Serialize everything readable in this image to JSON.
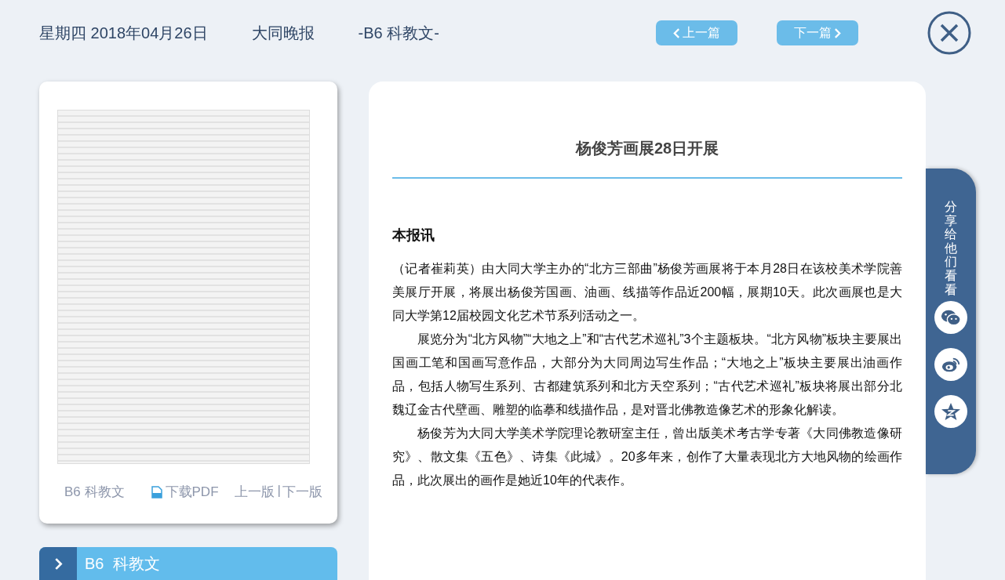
{
  "header": {
    "date": "星期四 2018年04月26日",
    "paper": "大同晚报",
    "page_label": "-B6 科教文-"
  },
  "nav_buttons": [
    {
      "kind": "prev",
      "label": "上一篇"
    },
    {
      "kind": "next",
      "label": "下一篇"
    }
  ],
  "page_card": {
    "page_name": "B6 科教文",
    "download": "下载PDF",
    "prev_page": "上一版",
    "separator": "|",
    "next_page": "下一版"
  },
  "section_tab": {
    "label": "B6  科教文"
  },
  "article": {
    "title": "杨俊芳画展28日开展",
    "lead": "本报讯",
    "paragraphs": [
      {
        "indent": false,
        "text": "（记者崔莉英）由大同大学主办的“北方三部曲”杨俊芳画展将于本月28日在该校美术学院善美展厅开展，将展出杨俊芳国画、油画、线描等作品近200幅，展期10天。此次画展也是大同大学第12届校园文化艺术节系列活动之一。"
      },
      {
        "indent": true,
        "text": "展览分为“北方风物”“大地之上”和“古代艺术巡礼”3个主题板块。“北方风物”板块主要展出国画工笔和国画写意作品，大部分为大同周边写生作品；“大地之上”板块主要展出油画作品，包括人物写生系列、古都建筑系列和北方天空系列；“古代艺术巡礼”板块将展出部分北魏辽金古代壁画、雕塑的临摹和线描作品，是对晋北佛教造像艺术的形象化解读。"
      },
      {
        "indent": true,
        "text": "杨俊芳为大同大学美术学院理论教研室主任，曾出版美术考古学专著《大同佛教造像研究》、散文集《五色》、诗集《此城》。20多年来，创作了大量表现北方大地风物的绘画作品，此次展出的画作是她近10年的代表作。"
      }
    ]
  },
  "share": {
    "label": "分享给他们看看",
    "buttons": [
      {
        "kind": "wechat"
      },
      {
        "kind": "weibo"
      },
      {
        "kind": "qzone"
      }
    ]
  }
}
